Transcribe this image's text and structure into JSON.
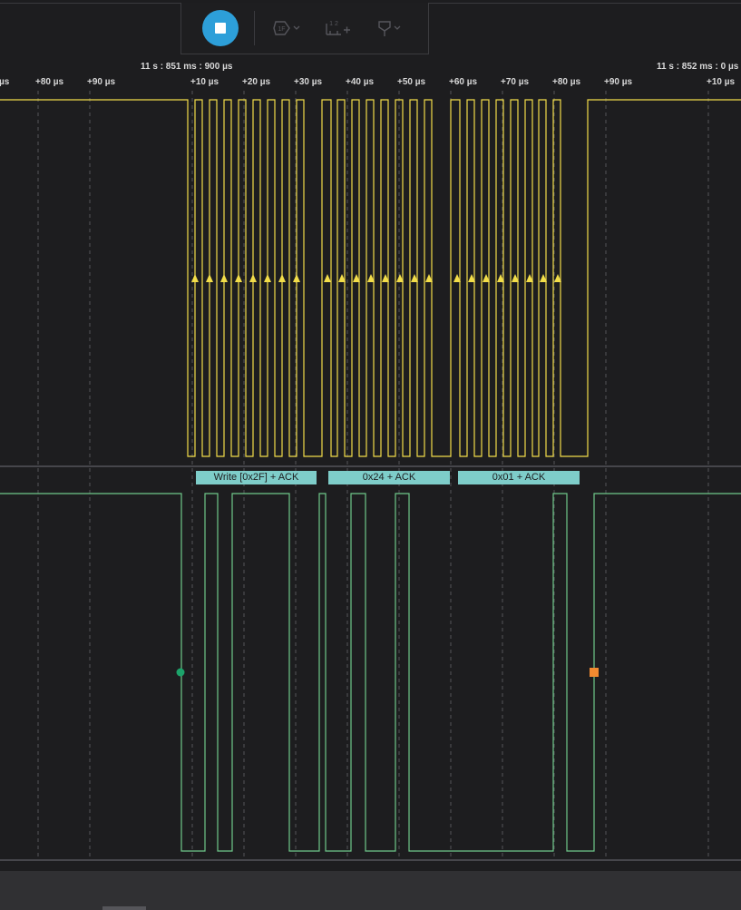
{
  "toolbar": {
    "stop_icon": "stop-icon",
    "icons": [
      "measure-icon",
      "timing-marker-icon",
      "trigger-icon"
    ]
  },
  "timeline": {
    "anchor_left": "11 s : 851 ms : 900 µs",
    "anchor_right": "11 s : 852 ms : 0 µs",
    "ticks": [
      "µs",
      "+80 µs",
      "+90 µs",
      "+10 µs",
      "+20 µs",
      "+30 µs",
      "+40 µs",
      "+50 µs",
      "+60 µs",
      "+70 µs",
      "+80 µs",
      "+90 µs",
      "+10 µs"
    ]
  },
  "decoder": {
    "frames": [
      "Write [0x2F] + ACK",
      "0x24 + ACK",
      "0x01 + ACK"
    ]
  },
  "colors": {
    "background": "#1d1d1f",
    "clock_channel": "#f2dd4a",
    "data_channel": "#6fc98a",
    "decoder_label": "#7ecdc9",
    "stop_button": "#2d9fd9",
    "start_marker": "#1ca36a",
    "stop_marker": "#f08a30"
  }
}
